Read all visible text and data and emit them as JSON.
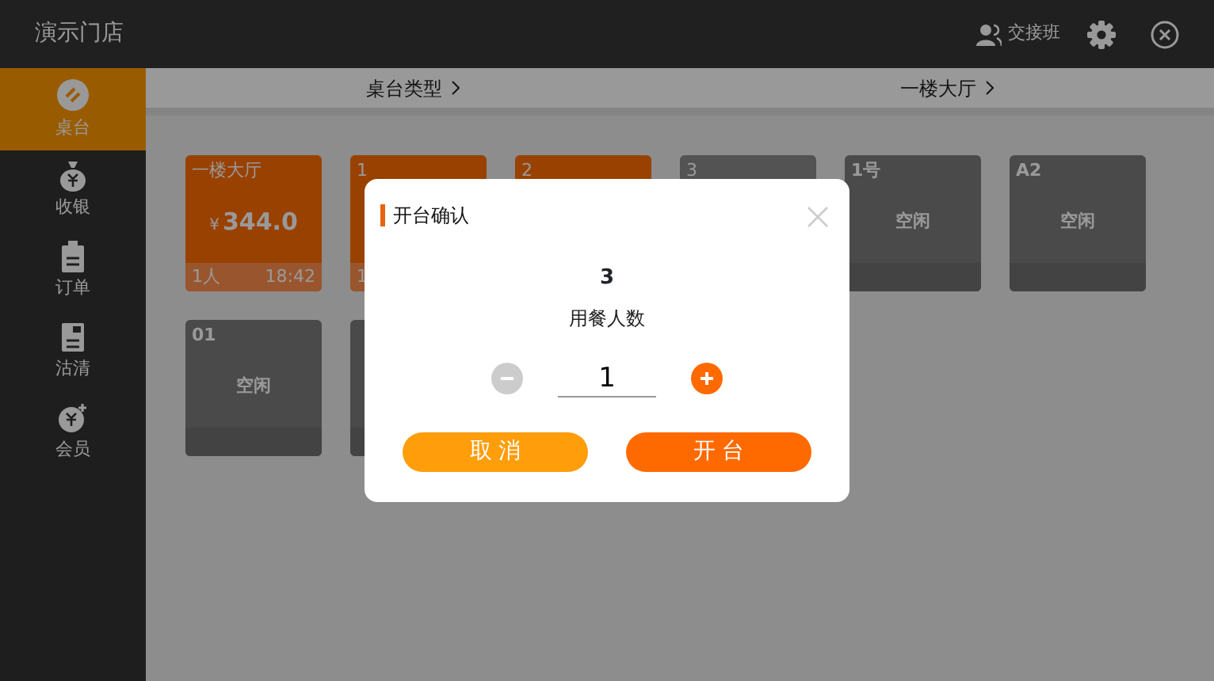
{
  "app_bar": {
    "store_name": "演示门店",
    "handover": "交接班"
  },
  "sidebar": {
    "items": [
      {
        "label": "桌台",
        "selected": true
      },
      {
        "label": "收银",
        "selected": false
      },
      {
        "label": "订单",
        "selected": false
      },
      {
        "label": "沽清",
        "selected": false
      },
      {
        "label": "会员",
        "selected": false
      }
    ]
  },
  "filters": [
    {
      "label": "桌台类型"
    },
    {
      "label": "一楼大厅"
    }
  ],
  "tables": [
    {
      "kind": "occupied",
      "label": "一楼大厅",
      "currency": "¥",
      "amount": "344.0",
      "guests": "1人",
      "time": "18:42"
    },
    {
      "kind": "occupied",
      "label": "1",
      "guests": "1"
    },
    {
      "kind": "occupied",
      "label": "2"
    },
    {
      "kind": "busy",
      "label": "3"
    },
    {
      "kind": "idle",
      "label": "1号",
      "status": "空闲"
    },
    {
      "kind": "idle",
      "label": "A2",
      "status": "空闲"
    },
    {
      "kind": "idle",
      "label": "01",
      "status": "空闲"
    },
    {
      "kind": "idle"
    }
  ],
  "dialog": {
    "title": "开台确认",
    "table_name": "3",
    "guests_label": "用餐人数",
    "guests_value": "1",
    "cancel": "取 消",
    "confirm": "开 台"
  }
}
